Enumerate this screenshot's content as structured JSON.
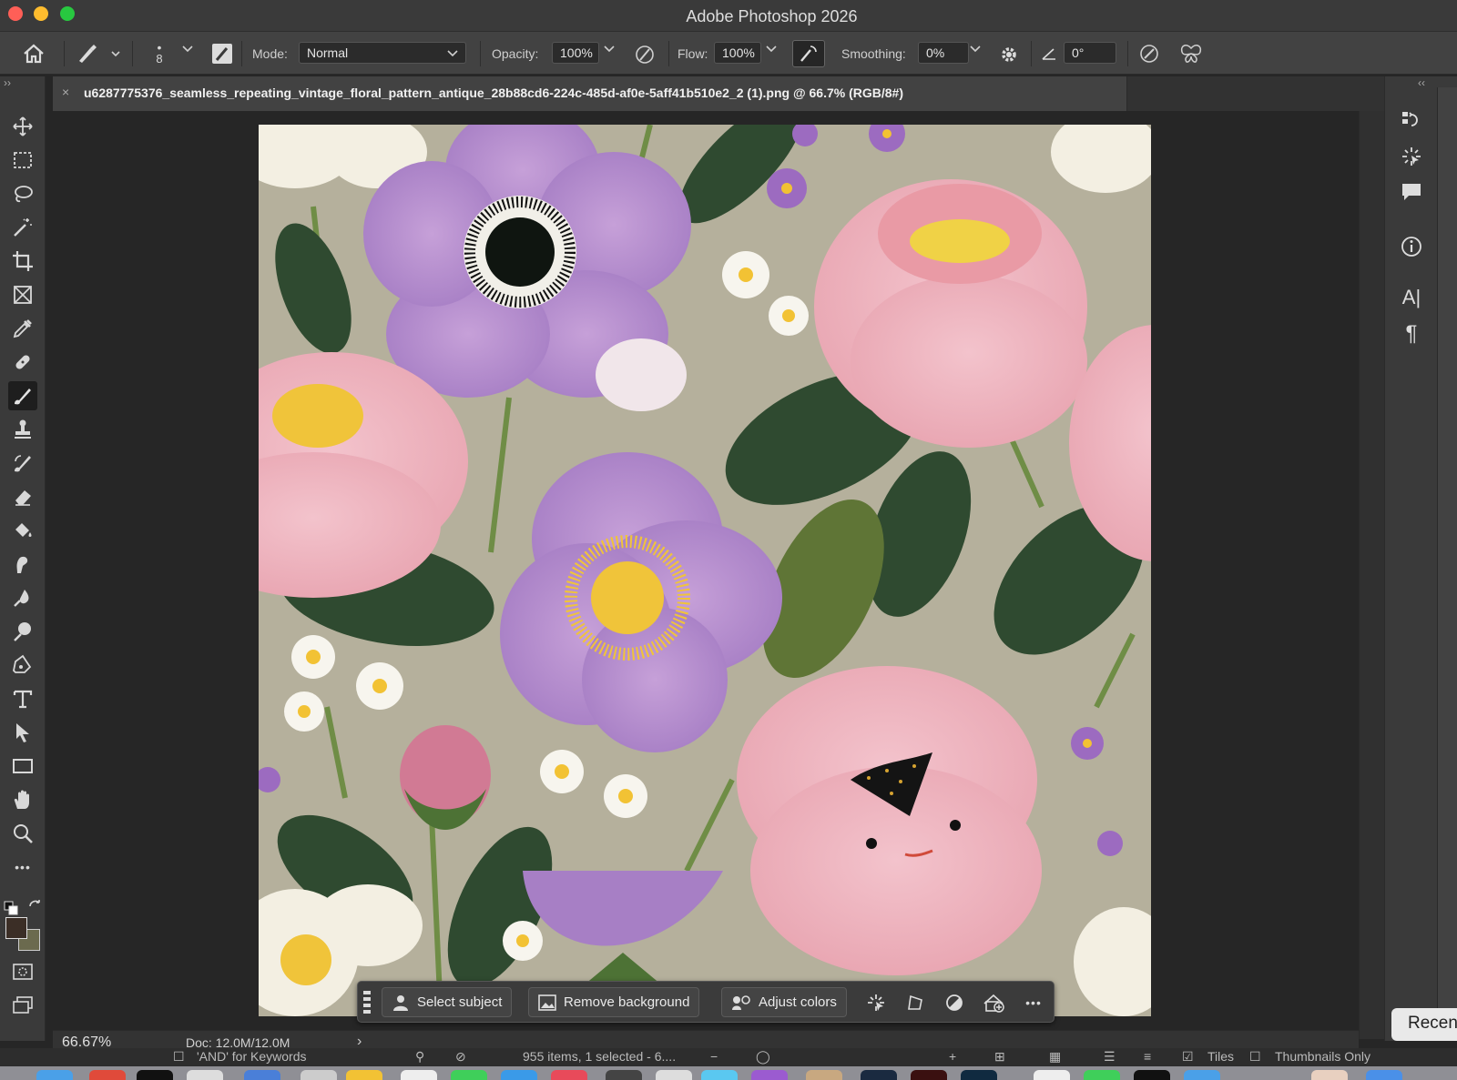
{
  "window": {
    "title": "Adobe Photoshop 2026",
    "traffic_lights": {
      "close": "#ff5f57",
      "minimize": "#febc2e",
      "zoom": "#28c840"
    }
  },
  "options_bar": {
    "brush_size": "8",
    "mode_label": "Mode:",
    "mode_value": "Normal",
    "opacity_label": "Opacity:",
    "opacity_value": "100%",
    "flow_label": "Flow:",
    "flow_value": "100%",
    "smoothing_label": "Smoothing:",
    "smoothing_value": "0%",
    "angle_value": "0°"
  },
  "document_tab": {
    "close_glyph": "×",
    "title": "u6287775376_seamless_repeating_vintage_floral_pattern_antique_28b88cd6-224c-485d-af0e-5aff41b510e2_2 (1).png @ 66.7% (RGB/8#)"
  },
  "tools": [
    "move-tool-icon",
    "marquee-tool-icon",
    "lasso-tool-icon",
    "magic-wand-icon",
    "crop-tool-icon",
    "frame-tool-icon",
    "eyedropper-icon",
    "healing-brush-icon",
    "brush-tool-icon",
    "clone-stamp-icon",
    "history-brush-icon",
    "eraser-icon",
    "paint-bucket-icon",
    "smudge-tool-icon",
    "blur-tool-icon",
    "dodge-tool-icon",
    "pen-tool-icon",
    "type-tool-icon",
    "path-selection-icon",
    "rectangle-tool-icon",
    "hand-tool-icon",
    "zoom-tool-icon",
    "more-tools-icon"
  ],
  "colors": {
    "foreground": "#3b2e26",
    "background": "#6b6a4e",
    "canvas_bg": "#b5b09c"
  },
  "context_bar": {
    "select_subject": "Select subject",
    "remove_background": "Remove background",
    "adjust_colors": "Adjust colors",
    "more_glyph": "•••"
  },
  "status_bar": {
    "zoom": "66.67%",
    "doc": "Doc: 12.0M/12.0M",
    "arrow": "›"
  },
  "bridge": {
    "keywords": "'AND' for Keywords",
    "items": "955 items, 1 selected - 6....",
    "tiles": "Tiles",
    "thumbnails_only": "Thumbnails Only"
  },
  "recent_tooltip": "Recen"
}
